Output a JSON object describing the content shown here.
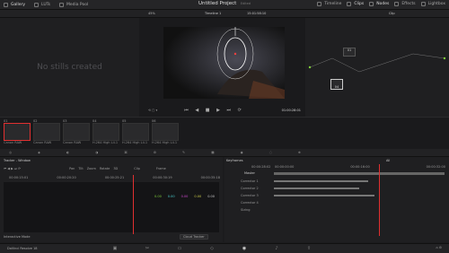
{
  "topbar": {
    "tabs": [
      {
        "label": "Gallery",
        "active": true
      },
      {
        "label": "LUTs"
      },
      {
        "label": "Media Pool"
      }
    ],
    "project_title": "Untitled Project",
    "project_status": "Edited",
    "right_tabs": [
      {
        "label": "Timeline"
      },
      {
        "label": "Clips",
        "active": true
      },
      {
        "label": "Nodes",
        "active": true
      },
      {
        "label": "Effects"
      },
      {
        "label": "Lightbox"
      }
    ]
  },
  "viewer_bar": {
    "zoom": "45%",
    "timeline_name": "Timeline 1",
    "timecode_top": "15:01:58:10",
    "clip_menu": "Clip"
  },
  "gallery": {
    "empty_text": "No stills created"
  },
  "viewer": {
    "timecode": "01:00:28:01"
  },
  "clips": [
    {
      "index": "01",
      "label": "Canon RAW",
      "selected": true
    },
    {
      "index": "02",
      "label": "Canon RAW"
    },
    {
      "index": "03",
      "label": "Canon RAW"
    },
    {
      "index": "04",
      "label": "H.264 High L4.1"
    },
    {
      "index": "05",
      "label": "H.264 High L4.1"
    },
    {
      "index": "06",
      "label": "H.264 High L4.1"
    }
  ],
  "nodes": [
    {
      "label": "01"
    },
    {
      "label": "04"
    }
  ],
  "tracker": {
    "title": "Tracker - Window",
    "checks": [
      "Pan",
      "Tilt",
      "Zoom",
      "Rotate",
      "3D"
    ],
    "mode_labels": [
      "Clip",
      "Frame"
    ],
    "ruler": [
      "00:00:15:01",
      "00:00:20:20",
      "00:00:25:21",
      "00:00:30:19",
      "00:00:35:18"
    ],
    "values": [
      "0.00",
      "0.00",
      "0.00",
      "0.00",
      "0.00"
    ],
    "footer_left": "Interactive Mode",
    "footer_right": "Cloud Tracker"
  },
  "keyframes": {
    "title": "Keyframes",
    "filter": "All",
    "timecode": "00:00:28:02",
    "master": "Master",
    "ruler": [
      "00:00:00:00",
      "00:00:16:00",
      "00:00:32:00"
    ],
    "rows": [
      {
        "label": "Corrector 1"
      },
      {
        "label": "Corrector 2"
      },
      {
        "label": "Corrector 3"
      },
      {
        "label": "Corrector 4"
      },
      {
        "label": "Sizing"
      }
    ]
  },
  "bottombar": {
    "app_name": "DaVinci Resolve 18",
    "playhead_color": "#e03030"
  }
}
